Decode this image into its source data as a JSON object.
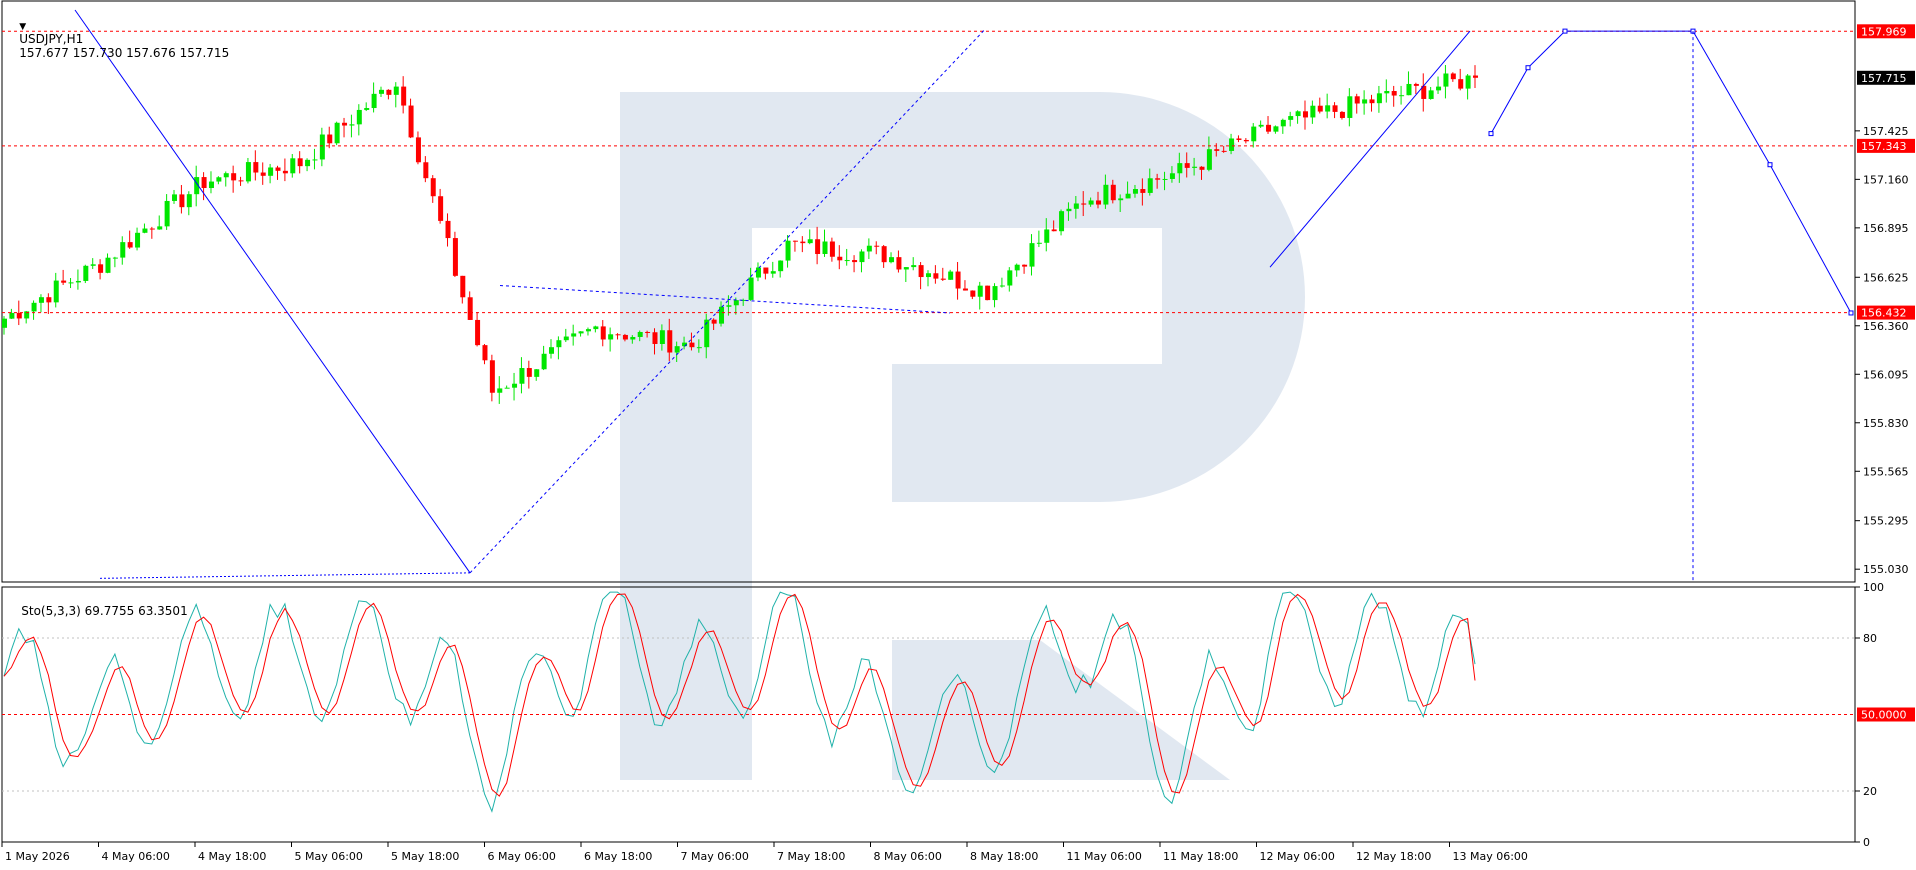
{
  "header": {
    "symbol": "USDJPY,H1",
    "ohlc": "157.677 157.730 157.676 157.715",
    "menu_arrow": "triangle-down-icon"
  },
  "indicator": {
    "label": "Sto(5,3,3) 69.7755 63.3501"
  },
  "colors": {
    "bull": "#00e600",
    "bear": "#ff0000",
    "stoch_main": "#20b2aa",
    "stoch_signal": "#ff0000",
    "forecast": "#0000ff",
    "level": "#ff0000",
    "watermark": "#d9e2ee",
    "grid": "#c0c0c0"
  },
  "chart_data": {
    "type": "candlestick",
    "symbol": "USDJPY",
    "timeframe": "H1",
    "ylim": [
      154.96,
      158.14
    ],
    "price_ticks": [
      "157.425",
      "157.160",
      "156.895",
      "156.625",
      "156.360",
      "156.095",
      "155.830",
      "155.565",
      "155.295",
      "155.030"
    ],
    "price_tick_values": [
      157.425,
      157.16,
      156.895,
      156.625,
      156.36,
      156.095,
      155.83,
      155.565,
      155.295,
      155.03
    ],
    "time_labels": [
      "1 May 2026",
      "4 May 06:00",
      "4 May 18:00",
      "5 May 06:00",
      "5 May 18:00",
      "6 May 06:00",
      "6 May 18:00",
      "7 May 06:00",
      "7 May 18:00",
      "8 May 06:00",
      "8 May 18:00",
      "11 May 06:00",
      "11 May 18:00",
      "12 May 06:00",
      "12 May 18:00",
      "13 May 06:00"
    ],
    "levels": [
      {
        "value": 157.969,
        "label": "157.969"
      },
      {
        "value": 157.343,
        "label": "157.343"
      },
      {
        "value": 156.432,
        "label": "156.432"
      }
    ],
    "current_price": {
      "value": 157.715,
      "label": "157.715"
    },
    "anchors": [
      {
        "t": "1 May 2026",
        "price": 156.4,
        "stoch": 65
      },
      {
        "t": "4 May 06:00",
        "price": 156.7,
        "stoch": 45
      },
      {
        "t": "4 May 18:00",
        "price": 157.15,
        "stoch": 72
      },
      {
        "t": "5 May 06:00",
        "price": 157.25,
        "stoch": 70
      },
      {
        "t": "5 May 18:00",
        "price": 157.7,
        "stoch": 75
      },
      {
        "t": "6 May 06:00",
        "price": 156.0,
        "stoch": 35
      },
      {
        "t": "6 May 18:00",
        "price": 156.35,
        "stoch": 85
      },
      {
        "t": "7 May 06:00",
        "price": 156.25,
        "stoch": 60
      },
      {
        "t": "7 May 18:00",
        "price": 156.8,
        "stoch": 80
      },
      {
        "t": "8 May 06:00",
        "price": 156.75,
        "stoch": 40
      },
      {
        "t": "8 May 18:00",
        "price": 156.55,
        "stoch": 45
      },
      {
        "t": "11 May 06:00",
        "price": 157.05,
        "stoch": 85
      },
      {
        "t": "11 May 18:00",
        "price": 157.2,
        "stoch": 35
      },
      {
        "t": "12 May 06:00",
        "price": 157.45,
        "stoch": 80
      },
      {
        "t": "12 May 18:00",
        "price": 157.6,
        "stoch": 75
      },
      {
        "t": "13 May 06:00",
        "price": 157.715,
        "stoch": 69.7755
      }
    ],
    "candle_count": 200,
    "forecast_path": [
      157.97,
      157.41,
      157.77,
      157.97,
      157.97,
      157.24,
      156.43
    ],
    "stochastic": {
      "params": "5,3,3",
      "main_last": 69.7755,
      "signal_last": 63.3501,
      "ylim": [
        0,
        100
      ],
      "ticks": [
        "100",
        "80",
        "20",
        "0"
      ],
      "tick_values": [
        100,
        80,
        20,
        0
      ],
      "level": {
        "value": 50,
        "label": "50.0000"
      }
    }
  }
}
